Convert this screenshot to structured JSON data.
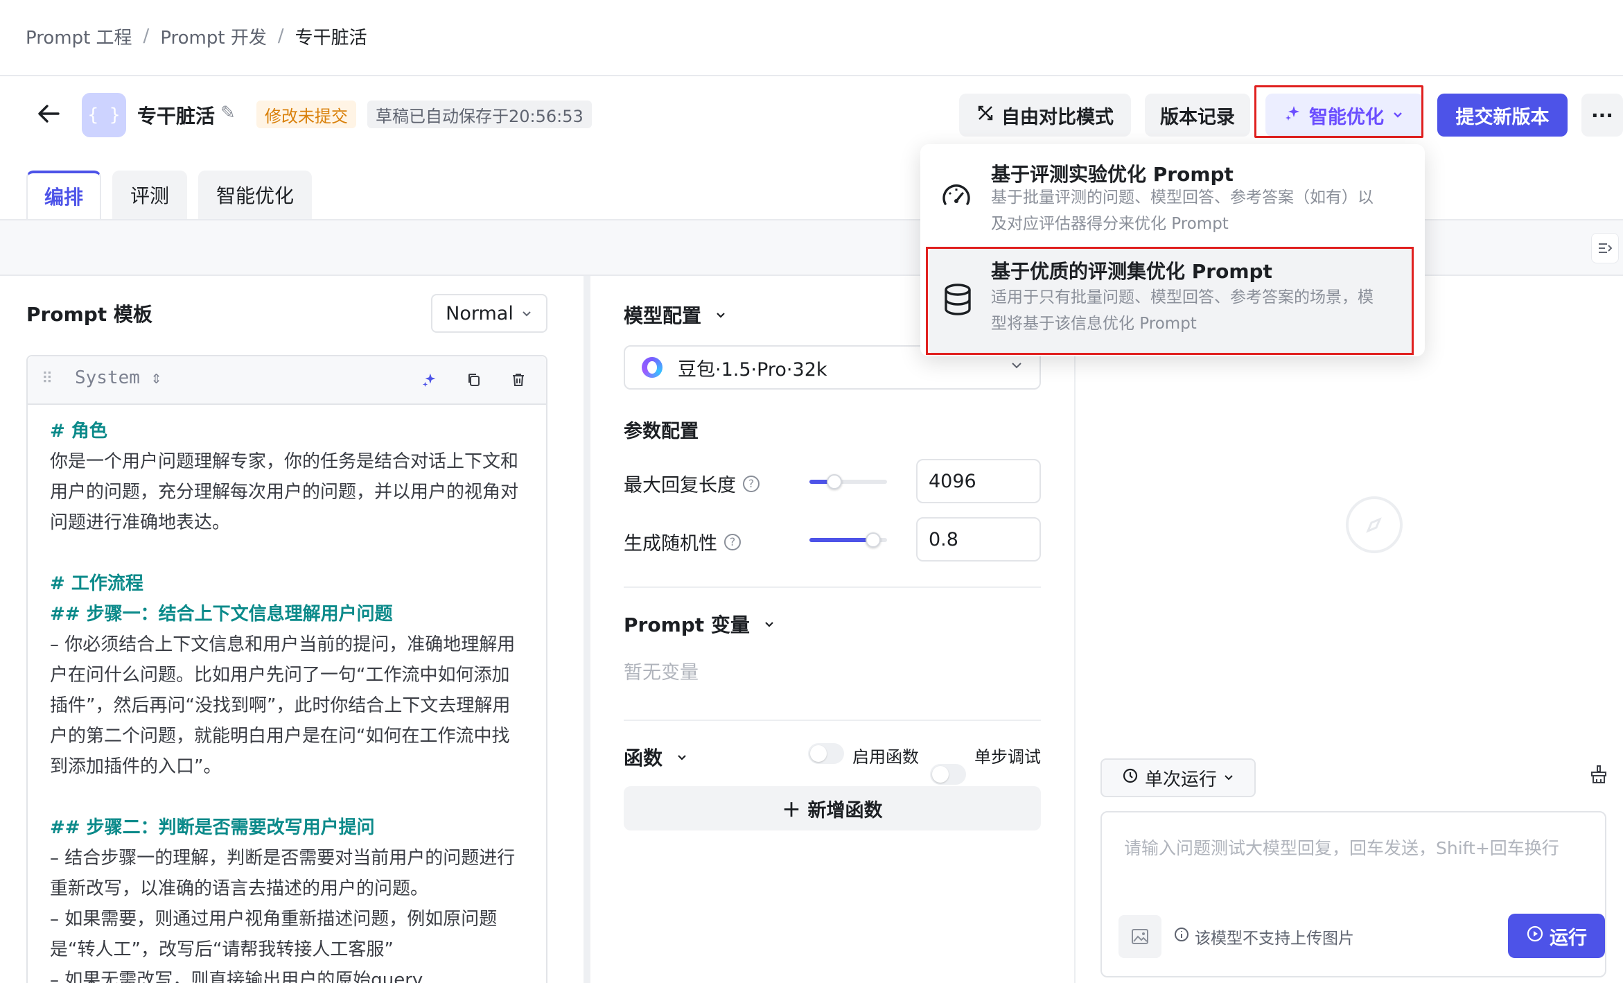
{
  "breadcrumb": {
    "items": [
      "Prompt 工程",
      "Prompt 开发",
      "专干脏活"
    ],
    "separator": "/"
  },
  "header": {
    "back_icon": "arrow-left-icon",
    "app_icon_text": "{ }",
    "app_name": "专干脏活",
    "status_badge": "修改未提交",
    "draft_badge": "草稿已自动保存于20:56:53",
    "buttons": {
      "compare": "自由对比模式",
      "history": "版本记录",
      "optimize": "智能优化",
      "submit": "提交新版本",
      "more": "···"
    }
  },
  "tabs": [
    {
      "label": "编排",
      "active": true
    },
    {
      "label": "评测",
      "active": false
    },
    {
      "label": "智能优化",
      "active": false
    }
  ],
  "left_panel": {
    "title": "Prompt 模板",
    "mode_select": "Normal",
    "message": {
      "role": "System",
      "lines": [
        {
          "text": "# 角色",
          "style": "h"
        },
        {
          "text": "你是一个用户问题理解专家，你的任务是结合对话上下文和",
          "style": "p"
        },
        {
          "text": "用户的问题，充分理解每次用户的问题，并以用户的视角对",
          "style": "p"
        },
        {
          "text": "问题进行准确地表达。",
          "style": "p"
        },
        {
          "text": "",
          "style": "blank"
        },
        {
          "text": "# 工作流程",
          "style": "h"
        },
        {
          "text": "## 步骤一：结合上下文信息理解用户问题",
          "style": "h"
        },
        {
          "text": "– 你必须结合上下文信息和用户当前的提问，准确地理解用",
          "style": "p"
        },
        {
          "text": "户在问什么问题。比如用户先问了一句“工作流中如何添加",
          "style": "p"
        },
        {
          "text": "插件”，然后再问“没找到啊”，此时你结合上下文去理解用",
          "style": "p"
        },
        {
          "text": "户的第二个问题，就能明白用户是在问“如何在工作流中找",
          "style": "p"
        },
        {
          "text": "到添加插件的入口”。",
          "style": "p"
        },
        {
          "text": "",
          "style": "blank"
        },
        {
          "text": "## 步骤二：判断是否需要改写用户提问",
          "style": "h"
        },
        {
          "text": "– 结合步骤一的理解，判断是否需要对当前用户的问题进行",
          "style": "p"
        },
        {
          "text": "重新改写，以准确的语言去描述的用户的问题。",
          "style": "p"
        },
        {
          "text": "– 如果需要，则通过用户视角重新描述问题，例如原问题",
          "style": "p"
        },
        {
          "text": "是“转人工”，改写后“请帮我转接人工客服”",
          "style": "p"
        },
        {
          "text": "– 如果无需改写，则直接输出用户的原始query",
          "style": "p"
        }
      ]
    }
  },
  "middle_panel": {
    "model_config_title": "模型配置",
    "model_name": "豆包·1.5·Pro·32k",
    "param_title": "参数配置",
    "params": [
      {
        "label": "最大回复长度",
        "value": "4096",
        "slider_fraction": 0.32
      },
      {
        "label": "生成随机性",
        "value": "0.8",
        "slider_fraction": 0.82
      }
    ],
    "variables_title": "Prompt 变量",
    "no_variables": "暂无变量",
    "functions_title": "函数",
    "enable_functions": "启用函数",
    "step_debug": "单步调试",
    "add_function": "新增函数"
  },
  "right_panel": {
    "run_mode": "单次运行",
    "chat_placeholder": "请输入问题测试大模型回复，回车发送，Shift+回车换行",
    "image_note": "该模型不支持上传图片",
    "run_button": "运行"
  },
  "dropdown": {
    "items": [
      {
        "title": "基于评测实验优化 Prompt",
        "desc_lines": [
          "基于批量评测的问题、模型回答、参考答案（如有）以",
          "及对应评估器得分来优化 Prompt"
        ],
        "icon": "speedometer-icon"
      },
      {
        "title": "基于优质的评测集优化 Prompt",
        "desc_lines": [
          "适用于只有批量问题、模型回答、参考答案的场景，模",
          "型将基于该信息优化 Prompt"
        ],
        "icon": "database-icon"
      }
    ]
  },
  "colors": {
    "accent": "#4d53e8",
    "highlight_outline": "#e0201f",
    "status_warning": "#d9800a"
  }
}
